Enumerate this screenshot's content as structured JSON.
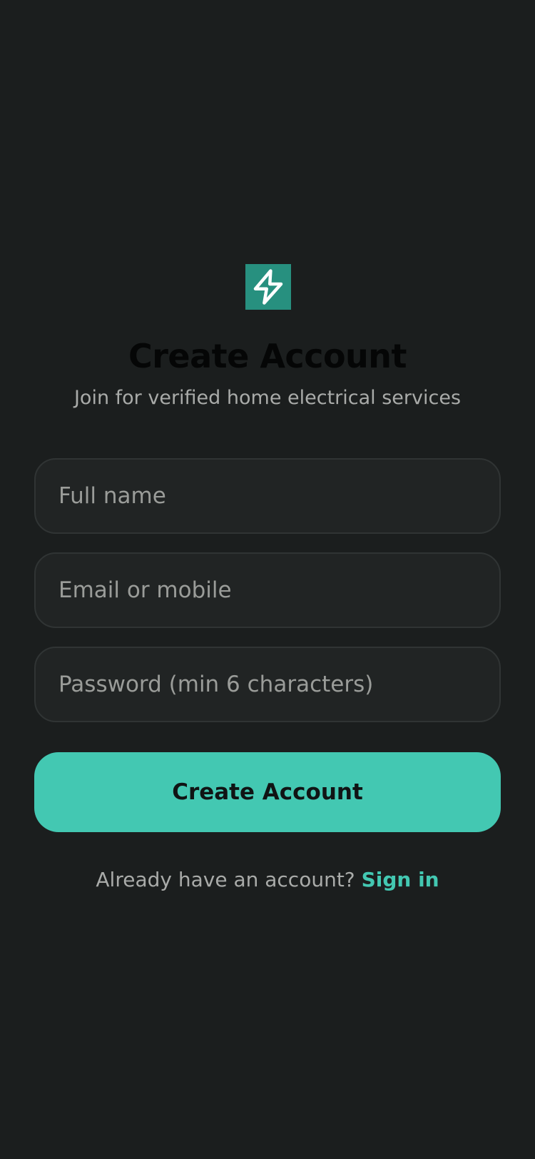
{
  "app": {
    "logo_icon": "lightning-bolt-icon",
    "logo_bg_color": "#27907f",
    "accent_color": "#43c8b2",
    "background_color": "#1b1e1e"
  },
  "header": {
    "title": "Create Account",
    "subtitle": "Join for verified home electrical services"
  },
  "form": {
    "full_name": {
      "placeholder": "Full name",
      "value": ""
    },
    "email": {
      "placeholder": "Email or mobile",
      "value": ""
    },
    "password": {
      "placeholder": "Password (min 6 characters)",
      "value": ""
    },
    "submit_label": "Create Account"
  },
  "footer": {
    "prompt": "Already have an account?",
    "link_label": "Sign in"
  }
}
